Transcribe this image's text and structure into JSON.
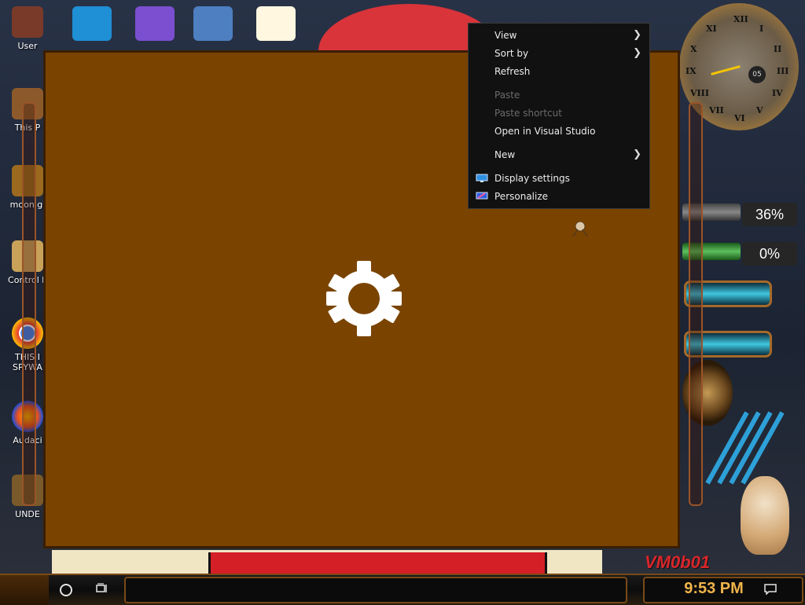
{
  "desktop": {
    "icons_left": [
      {
        "label": "User",
        "icon": "user-folder-icon",
        "color": "#7a3a2a"
      },
      {
        "label": "This P",
        "icon": "this-pc-icon",
        "color": "#8c5a2a"
      },
      {
        "label": "moon gi",
        "icon": "moon-gif-icon",
        "color": "#9b6a1e"
      },
      {
        "label": "Control P",
        "icon": "control-panel-icon",
        "color": "#c9a25a"
      },
      {
        "label": "THIS I",
        "label2": "SPYWA",
        "icon": "chrome-icon",
        "color": "#e53935"
      },
      {
        "label": "Audaci",
        "icon": "audacity-icon",
        "color": "#1d4ed8"
      },
      {
        "label": "UNDE",
        "icon": "gear-folder-icon",
        "color": "#7a5a2a"
      }
    ],
    "icons_top": [
      {
        "icon": "edge-icon",
        "color": "#1f8fd6"
      },
      {
        "icon": "visual-studio-icon",
        "color": "#7b4fcf"
      },
      {
        "icon": "virtualbox-icon",
        "color": "#4d7fc1"
      },
      {
        "icon": "hxd-icon",
        "color": "#fff7e0"
      }
    ],
    "accent_colors": {
      "window_bg": "#7a4400",
      "menu_bg": "#111111",
      "clock_text": "#f0b44b"
    }
  },
  "context_menu": {
    "items": [
      {
        "label": "View",
        "submenu": true,
        "disabled": false
      },
      {
        "label": "Sort by",
        "submenu": true,
        "disabled": false
      },
      {
        "label": "Refresh",
        "submenu": false,
        "disabled": false
      },
      {
        "label": "Paste",
        "submenu": false,
        "disabled": true
      },
      {
        "label": "Paste shortcut",
        "submenu": false,
        "disabled": true
      },
      {
        "label": "Open in Visual Studio",
        "submenu": false,
        "disabled": false
      },
      {
        "label": "New",
        "submenu": true,
        "disabled": false
      },
      {
        "label": "Display settings",
        "submenu": false,
        "disabled": false,
        "icon": "display-icon"
      },
      {
        "label": "Personalize",
        "submenu": false,
        "disabled": false,
        "icon": "personalize-icon"
      }
    ]
  },
  "widgets": {
    "clock_numerals": [
      "XII",
      "I",
      "II",
      "III",
      "IV",
      "V",
      "VI",
      "VII",
      "VIII",
      "IX",
      "X",
      "XI"
    ],
    "clock_subdial": "05",
    "meter_1": {
      "text": "36%",
      "value": 0.36
    },
    "meter_2": {
      "text": "0%",
      "value": 0.0
    },
    "signature": "VM0b01"
  },
  "taskbar": {
    "time": "9:53 PM"
  }
}
